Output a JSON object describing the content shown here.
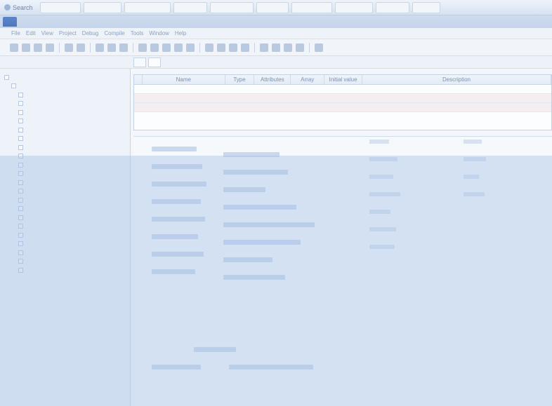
{
  "taskbar": {
    "start_label": "Search",
    "items": [
      "",
      "",
      "",
      "",
      "",
      "",
      "",
      "",
      "",
      ""
    ]
  },
  "window": {
    "title": ""
  },
  "menubar": {
    "items": [
      "File",
      "Edit",
      "View",
      "Project",
      "Debug",
      "Compile",
      "Tools",
      "Window",
      "Help"
    ]
  },
  "pathbar": {
    "tab1": "",
    "tab2": ""
  },
  "tree": {
    "items": [
      {
        "label": "",
        "depth": 0
      },
      {
        "label": "",
        "depth": 1
      },
      {
        "label": "",
        "depth": 2
      },
      {
        "label": "",
        "depth": 2
      },
      {
        "label": "",
        "depth": 2
      },
      {
        "label": "",
        "depth": 2
      },
      {
        "label": "",
        "depth": 2
      },
      {
        "label": "",
        "depth": 2
      },
      {
        "label": "",
        "depth": 2
      },
      {
        "label": "",
        "depth": 2
      },
      {
        "label": "",
        "depth": 2
      },
      {
        "label": "",
        "depth": 2
      },
      {
        "label": "",
        "depth": 2
      },
      {
        "label": "",
        "depth": 2
      },
      {
        "label": "",
        "depth": 2
      },
      {
        "label": "",
        "depth": 2
      },
      {
        "label": "",
        "depth": 2
      },
      {
        "label": "",
        "depth": 2
      },
      {
        "label": "",
        "depth": 2
      },
      {
        "label": "",
        "depth": 2
      },
      {
        "label": "",
        "depth": 2
      },
      {
        "label": "",
        "depth": 2
      },
      {
        "label": "",
        "depth": 2
      }
    ]
  },
  "grid": {
    "headers": [
      "",
      "Name",
      "Type",
      "Attributes",
      "Array",
      "Initial value",
      "Description"
    ],
    "rows": [
      [
        "",
        "",
        "",
        "",
        "",
        "",
        ""
      ],
      [
        "",
        "",
        "",
        "",
        "",
        "",
        ""
      ],
      [
        "",
        "",
        "",
        "",
        "",
        "",
        ""
      ]
    ]
  }
}
